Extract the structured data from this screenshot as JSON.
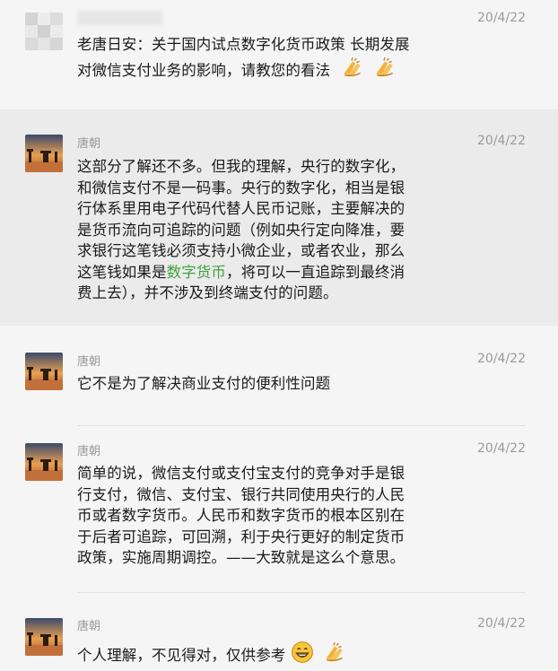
{
  "messages": [
    {
      "sender": "",
      "time": "20/4/22",
      "lines": [
        "老唐日安：关于国内试点数字化货币政策 长期发展",
        "对微信支付业务的影响，请教您的看法"
      ],
      "emojis": [
        "clap-icon",
        "clap-icon"
      ]
    },
    {
      "sender": "唐朝",
      "time": "20/4/22",
      "lines": [
        "这部分了解还不多。但我的理解，央行的数字化，",
        "和微信支付不是一码事。央行的数字化，相当是银",
        "行体系里用电子代码代替人民币记账，主要解决的",
        "是货币流向可追踪的问题（例如央行定向降准，要",
        "求银行这笔钱必须支持小微企业，或者农业，那么"
      ],
      "line6_pre": "这笔钱如果是",
      "link_text": "数字货币",
      "line6_post": "，将可以一直追踪到最终消",
      "line7": "费上去），并不涉及到终端支付的问题。"
    },
    {
      "sender": "唐朝",
      "time": "20/4/22",
      "lines": [
        "它不是为了解决商业支付的便利性问题"
      ]
    },
    {
      "sender": "唐朝",
      "time": "20/4/22",
      "lines": [
        "简单的说，微信支付或支付宝支付的竞争对手是银",
        "行支付，微信、支付宝、银行共同使用央行的人民",
        "币或者数字货币。人民币和数字货币的根本区别在",
        "于后者可追踪，可回溯，利于央行更好的制定货币",
        "政策，实施周期调控。——大致就是这么个意思。"
      ]
    },
    {
      "sender": "唐朝",
      "time": "20/4/22",
      "lines": [
        "个人理解，不见得对，仅供参考"
      ],
      "emojis": [
        "grin-icon",
        "clap-icon"
      ]
    }
  ]
}
